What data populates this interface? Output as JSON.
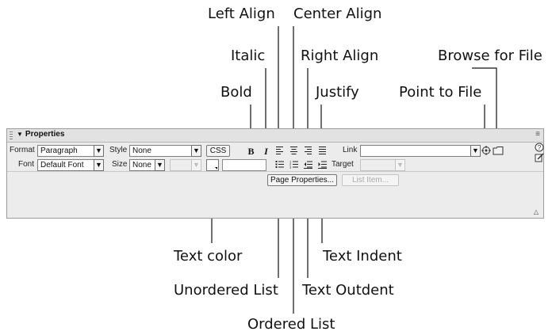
{
  "callouts": {
    "left_align": "Left Align",
    "center_align": "Center Align",
    "italic": "Italic",
    "right_align": "Right Align",
    "browse_for_file": "Browse for File",
    "bold": "Bold",
    "justify": "Justify",
    "point_to_file": "Point to File",
    "text_color": "Text color",
    "text_indent": "Text Indent",
    "unordered_list": "Unordered List",
    "text_outdent": "Text Outdent",
    "ordered_list": "Ordered List"
  },
  "panel": {
    "title": "Properties",
    "options_icon": "options-menu-icon",
    "row1": {
      "format_label": "Format",
      "format_value": "Paragraph",
      "style_label": "Style",
      "style_value": "None",
      "css_button": "CSS",
      "bold_glyph": "B",
      "italic_glyph": "I",
      "link_label": "Link",
      "link_value": ""
    },
    "row2": {
      "font_label": "Font",
      "font_value": "Default Font",
      "size_label": "Size",
      "size_value": "None",
      "target_label": "Target"
    },
    "row3": {
      "page_properties_button": "Page Properties...",
      "list_item_button": "List Item..."
    }
  },
  "icons": {
    "left_align": "align-left-icon",
    "center_align": "align-center-icon",
    "right_align": "align-right-icon",
    "justify": "align-justify-icon",
    "unordered_list": "unordered-list-icon",
    "ordered_list": "ordered-list-icon",
    "text_outdent": "text-outdent-icon",
    "text_indent": "text-indent-icon",
    "point_to_file": "point-to-file-icon",
    "browse_for_file": "folder-icon",
    "help": "help-icon",
    "quick_tag_editor": "quick-tag-editor-icon"
  }
}
